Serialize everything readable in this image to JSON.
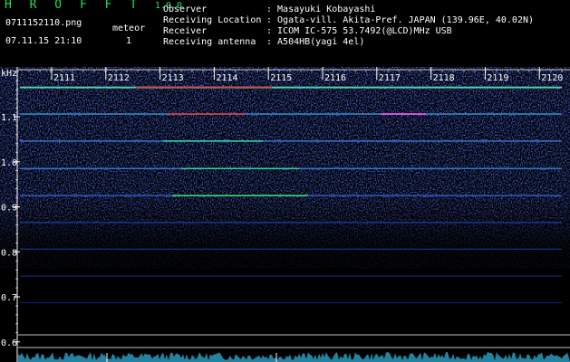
{
  "header": {
    "app_title": "H R O F F T",
    "version": "1.0.0",
    "filename": "0711152110.png",
    "meteor_label": "meteor",
    "meteor_count": "1",
    "datetime": "07.11.15 21:10",
    "info_labels": [
      "Observer",
      "Receiving Location",
      "Receiver",
      "Receiving antenna"
    ],
    "info_values": [
      ": Masayuki Kobayashi",
      ": Ogata-vill. Akita-Pref. JAPAN (139.96E, 40.02N)",
      ": ICOM IC-575 53.7492(@LCD)MHz USB",
      ": A504HB(yagi 4el)"
    ]
  },
  "chart_data": {
    "type": "heatmap",
    "ylabel": "kHz",
    "y_ticks": [
      "1.1",
      "1.0",
      "0.9",
      "0.8",
      "0.7",
      "0.6"
    ],
    "x_ticks": [
      "2111",
      "2112",
      "2113",
      "2114",
      "2115",
      "2116",
      "2117",
      "2118",
      "2119",
      "2120"
    ],
    "ylim": [
      0.58,
      1.18
    ],
    "colors": {
      "background": "#000000",
      "noise": "#1a2bd0",
      "grid": "#ffffff",
      "trace_hot": "#ff3030",
      "trace_mid": "#30e0a0",
      "accent_green": "#22e05a"
    }
  }
}
